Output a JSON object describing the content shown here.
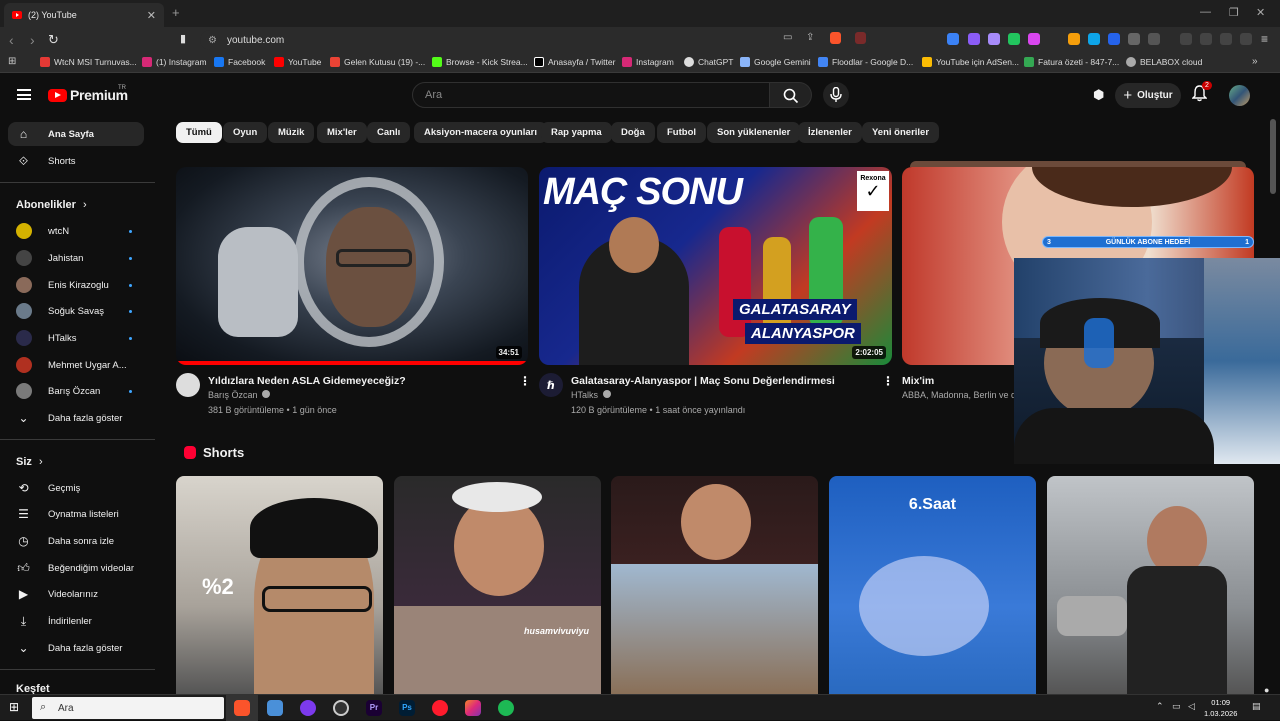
{
  "browser": {
    "tab_title": "(2) YouTube",
    "url": "youtube.com",
    "bookmarks": [
      {
        "label": "WtcN MSI Turnuvas...",
        "color": "#e53935"
      },
      {
        "label": "(1) Instagram",
        "color": "#d62976"
      },
      {
        "label": "Facebook",
        "color": "#1877f2"
      },
      {
        "label": "YouTube",
        "color": "#ff0000"
      },
      {
        "label": "Gelen Kutusu (19) -...",
        "color": "#ea4335"
      },
      {
        "label": "Browse - Kick Strea...",
        "color": "#53fc18"
      },
      {
        "label": "Anasayfa / Twitter",
        "color": "#ffffff"
      },
      {
        "label": "Instagram",
        "color": "#d62976"
      },
      {
        "label": "ChatGPT",
        "color": "#dddddd"
      },
      {
        "label": "Google Gemini",
        "color": "#8ab4f8"
      },
      {
        "label": "Floodlar - Google D...",
        "color": "#4285f4"
      },
      {
        "label": "YouTube için AdSen...",
        "color": "#fbbc04"
      },
      {
        "label": "Fatura özeti - 847-7...",
        "color": "#34a853"
      },
      {
        "label": "BELABOX cloud",
        "color": "#aaaaaa"
      }
    ]
  },
  "header": {
    "logo_text": "Premium",
    "region": "TR",
    "search_placeholder": "Ara",
    "create_label": "Oluştur",
    "notif_count": "2"
  },
  "sidebar": {
    "main": [
      {
        "label": "Ana Sayfa",
        "icon": "home-icon"
      },
      {
        "label": "Shorts",
        "icon": "shorts-icon"
      }
    ],
    "subs_heading": "Abonelikler",
    "subs": [
      {
        "label": "wtcN",
        "color": "#d4b200"
      },
      {
        "label": "Jahistan",
        "color": "#444444"
      },
      {
        "label": "Enis Kirazoglu",
        "color": "#8a6a5a"
      },
      {
        "label": "Soğuk Savaş",
        "color": "#6a7a8a"
      },
      {
        "label": "HTalks",
        "color": "#2a2a4a"
      },
      {
        "label": "Mehmet Uygar A...",
        "color": "#b03020"
      },
      {
        "label": "Barış Özcan",
        "color": "#7a7a7a"
      }
    ],
    "show_more": "Daha fazla göster",
    "you_heading": "Siz",
    "you": [
      {
        "label": "Geçmiş",
        "icon": "history-icon"
      },
      {
        "label": "Oynatma listeleri",
        "icon": "playlist-icon"
      },
      {
        "label": "Daha sonra izle",
        "icon": "clock-icon"
      },
      {
        "label": "Beğendiğim videolar",
        "icon": "like-icon"
      },
      {
        "label": "Videolarınız",
        "icon": "video-icon"
      },
      {
        "label": "İndirilenler",
        "icon": "download-icon"
      }
    ],
    "show_more_2": "Daha fazla göster",
    "explore_heading": "Keşfet"
  },
  "chips": [
    "Tümü",
    "Oyun",
    "Müzik",
    "Mix'ler",
    "Canlı",
    "Aksiyon-macera oyunları",
    "Rap yapma",
    "Doğa",
    "Futbol",
    "Son yüklenenler",
    "İzlenenler",
    "Yeni öneriler"
  ],
  "videos": [
    {
      "title": "Yıldızlara Neden ASLA Gidemeyeceğiz?",
      "channel": "Barış Özcan",
      "meta": "381 B görüntüleme • 1 gün önce",
      "duration": "34:51"
    },
    {
      "title": "Galatasaray-Alanyaspor | Maç Sonu Değerlendirmesi",
      "channel": "HTalks",
      "meta": "120 B görüntüleme • 1 saat önce yayınlandı",
      "duration": "2:02:05",
      "thumb_text": "MAÇ SONU",
      "thumb_sub1": "GALATASARAY",
      "thumb_sub2": "ALANYASPOR",
      "badge": "Rexona"
    },
    {
      "title": "Mix'im",
      "channel": "ABBA, Madonna, Berlin ve d"
    }
  ],
  "overlay_banner": {
    "left": "3",
    "label": "GÜNLÜK ABONE HEDEFİ",
    "right": "1"
  },
  "shorts": {
    "heading": "Shorts",
    "items": [
      {
        "text": "%2"
      },
      {
        "text": "husamvivuviyu"
      },
      {
        "text": ""
      },
      {
        "text": "6.Saat"
      },
      {
        "text": ""
      }
    ]
  },
  "taskbar": {
    "search": "Ara",
    "time": "01:09",
    "date": "1.03.2026"
  }
}
